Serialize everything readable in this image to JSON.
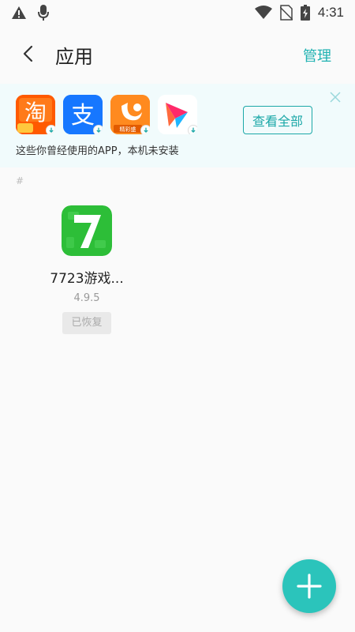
{
  "status_bar": {
    "time": "4:31",
    "icons": [
      "warning-icon",
      "mic-icon",
      "wifi-icon",
      "no-sim-icon",
      "battery-charging-icon"
    ]
  },
  "header": {
    "title": "应用",
    "manage_label": "管理"
  },
  "banner": {
    "apps": [
      {
        "name": "taobao",
        "icon_text": "淘",
        "color": "#ff6a00"
      },
      {
        "name": "alipay",
        "icon_text": "支",
        "color": "#1677ff"
      },
      {
        "name": "uc-browser",
        "icon_text": "",
        "color": "#ff8a1f",
        "badge_text": "精彩盛"
      },
      {
        "name": "video-app",
        "icon_text": "",
        "color": "#ffffff"
      }
    ],
    "description": "这些你曾经使用的APP，本机未安装",
    "view_all_label": "查看全部"
  },
  "section": {
    "header": "#"
  },
  "app_item": {
    "name": "7723游戏...",
    "version": "4.9.5",
    "status": "已恢复",
    "icon_color": "#2dbe38",
    "icon_glyph": "7"
  },
  "colors": {
    "accent": "#20b2b2",
    "fab": "#2bc4bb",
    "banner_bg": "#f1fbfc"
  }
}
